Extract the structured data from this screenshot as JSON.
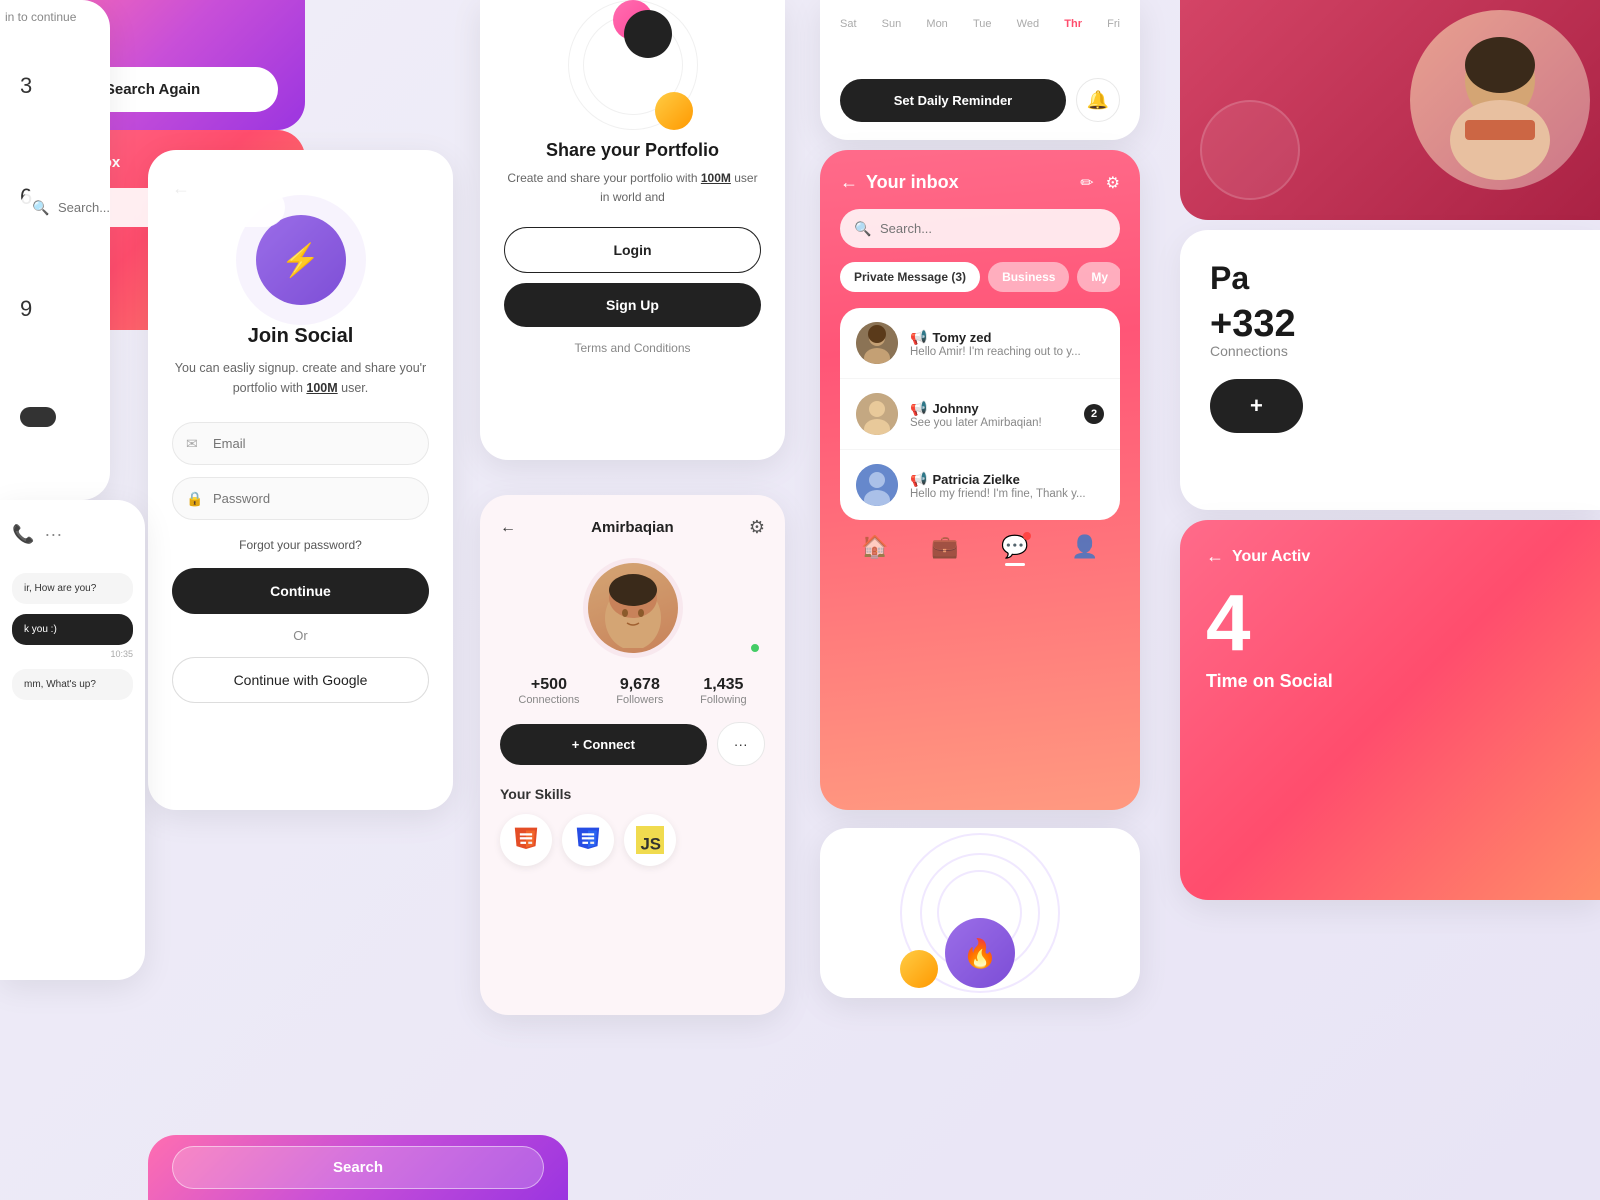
{
  "bg": "#f0eef8",
  "search_again": {
    "button_label": "Search Again"
  },
  "numbers": {
    "items": [
      "3",
      "6",
      "9"
    ]
  },
  "join_social": {
    "back_label": "←",
    "title": "Join Social",
    "description": "You can easliy signup. create and share you'r portfolio with ",
    "highlight": "100M",
    "description2": " user.",
    "email_placeholder": "Email",
    "password_placeholder": "Password",
    "forgot_label": "Forgot your password?",
    "continue_label": "Continue",
    "or_label": "Or",
    "google_label": "Continue with Google"
  },
  "inbox_small": {
    "back": "←",
    "title": "Your inbox",
    "search_placeholder": "Search..."
  },
  "portfolio": {
    "title": "Share your Portfolio",
    "description": "Create and share your portfolio with ",
    "highlight": "100M",
    "description2": " user in world and",
    "login_label": "Login",
    "signup_label": "Sign Up",
    "terms_label": "Terms and Conditions"
  },
  "profile": {
    "back": "←",
    "name": "Amirbaqian",
    "connections_val": "+500",
    "connections_lbl": "Connections",
    "followers_val": "9,678",
    "followers_lbl": "Followers",
    "following_val": "1,435",
    "following_lbl": "Following",
    "connect_label": "+ Connect",
    "skills_title": "Your Skills",
    "skills": [
      "HTML5",
      "CSS3",
      "JS"
    ]
  },
  "reminder": {
    "days": [
      "Sat",
      "Sun",
      "Mon",
      "Tue",
      "Wed",
      "Thr",
      "Fri"
    ],
    "active_day": "Thr",
    "button_label": "Set Daily Reminder"
  },
  "inbox_big": {
    "back": "←",
    "title": "Your inbox",
    "search_placeholder": "Search...",
    "tabs": [
      "Private Message (3)",
      "Business",
      "My"
    ],
    "messages": [
      {
        "name": "Tomy zed",
        "text": "Hello Amir! I'm reaching out to y...",
        "badge": null
      },
      {
        "name": "Johnny",
        "text": "See you later Amirbaqian!",
        "badge": "2"
      },
      {
        "name": "Patricia Zielke",
        "text": "Hello my friend! I'm fine, Thank y...",
        "badge": null
      }
    ]
  },
  "connections": {
    "page_label": "Pa",
    "count": "+332",
    "label": "Connections",
    "add_label": "+"
  },
  "activity": {
    "back": "←",
    "title": "Your Activ",
    "number": "4",
    "time_social": "Time on Social"
  },
  "search_bottom": {
    "label": "Search"
  },
  "chat": {
    "msg1": "ir, How are you?",
    "msg2": "k you :)",
    "msg2_time": "10:35",
    "msg3": "mm, What's up?"
  }
}
